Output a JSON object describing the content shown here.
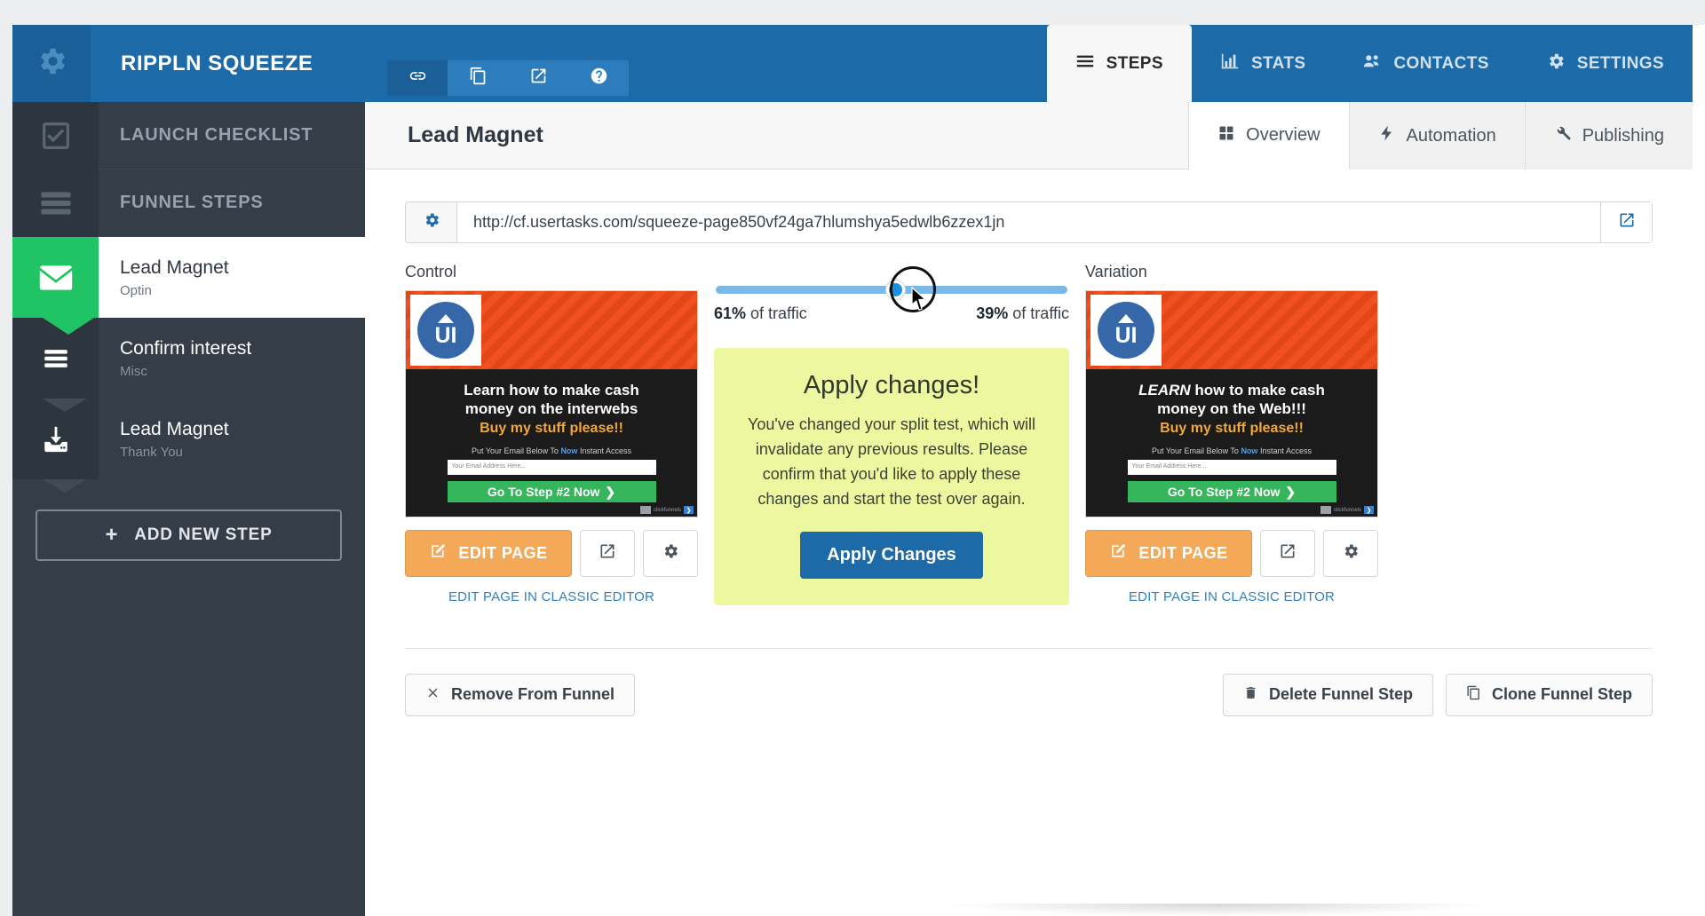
{
  "topbar": {
    "brand": "RIPPLN SQUEEZE",
    "gear_icon": "gear-icon",
    "quick_icons": [
      {
        "name": "link-icon",
        "active": true
      },
      {
        "name": "copy-icon",
        "active": false
      },
      {
        "name": "external-link-icon",
        "active": false
      },
      {
        "name": "help-circle-icon",
        "active": false
      }
    ],
    "nav_tabs": [
      {
        "label": "STEPS",
        "icon": "hamburger-icon",
        "active": true
      },
      {
        "label": "STATS",
        "icon": "bar-chart-icon",
        "active": false
      },
      {
        "label": "CONTACTS",
        "icon": "users-icon",
        "active": false
      },
      {
        "label": "SETTINGS",
        "icon": "gear-icon",
        "active": false
      }
    ]
  },
  "sidebar": {
    "headers": [
      {
        "label": "LAUNCH CHECKLIST",
        "icon": "checkbox-check-icon"
      },
      {
        "label": "FUNNEL STEPS",
        "icon": "hamburger-icon"
      }
    ],
    "steps": [
      {
        "title": "Lead Magnet",
        "subtitle": "Optin",
        "icon": "envelope-icon",
        "selected": true
      },
      {
        "title": "Confirm interest",
        "subtitle": "Misc",
        "icon": "hamburger-icon",
        "selected": false
      },
      {
        "title": "Lead Magnet",
        "subtitle": "Thank You",
        "icon": "download-inbox-icon",
        "selected": false
      }
    ],
    "add_step_label": "ADD NEW STEP",
    "add_step_plus": "+"
  },
  "main": {
    "page_title": "Lead Magnet",
    "tabs": [
      {
        "label": "Overview",
        "icon": "grid-icon",
        "active": true
      },
      {
        "label": "Automation",
        "icon": "bolt-icon",
        "active": false
      },
      {
        "label": "Publishing",
        "icon": "wrench-icon",
        "active": false
      }
    ],
    "url_bar": {
      "value": "http://cf.usertasks.com/squeeze-page850vf24ga7hlumshya5edwlb6zzex1jn",
      "settings_icon": "gear-icon",
      "open_icon": "external-link-icon"
    },
    "control": {
      "label": "Control",
      "edit_page_label": "EDIT PAGE",
      "classic_link": "EDIT PAGE IN CLASSIC EDITOR",
      "preview": {
        "logo_text": "UI",
        "headline": "Learn how to make cash",
        "headline2": "money on the interwebs",
        "subhead": "Buy my stuff please!!",
        "small_line_a": "Put Your Email Below To",
        "small_line_b": "Now",
        "small_line_c": "Instant Access",
        "input_placeholder": "Your Email Address Here...",
        "cta": "Go To Step #2 Now",
        "badge_text": "clickfunnels"
      }
    },
    "variation": {
      "label": "Variation",
      "edit_page_label": "EDIT PAGE",
      "classic_link": "EDIT PAGE IN CLASSIC EDITOR",
      "preview": {
        "logo_text": "UI",
        "headline_em": "LEARN",
        "headline": " how to make cash",
        "headline2": "money on the Web!!!",
        "subhead": "Buy my stuff please!!",
        "small_line_a": "Put Your Email Below To",
        "small_line_b": "Now",
        "small_line_c": "Instant Access",
        "input_placeholder": "Your Email Address Here...",
        "cta": "Go To Step #2 Now",
        "badge_text": "clickfunnels"
      }
    },
    "split": {
      "left_percent": "61%",
      "left_suffix": " of traffic",
      "right_percent": "39%",
      "right_suffix": " of traffic",
      "slider_position_percent": 51
    },
    "apply_panel": {
      "title": "Apply changes!",
      "body": "You've changed your split test, which will invalidate any previous results. Please confirm that you'd like to apply these changes and start the test over again.",
      "button_label": "Apply Changes"
    },
    "footer": {
      "remove_label": "Remove From Funnel",
      "remove_icon": "x-icon",
      "delete_label": "Delete Funnel Step",
      "delete_icon": "trash-icon",
      "clone_label": "Clone Funnel Step",
      "clone_icon": "copy-icon"
    }
  },
  "colors": {
    "brand_blue": "#1d6aa8",
    "sidebar_dark": "#343d48",
    "accent_green": "#21c464",
    "orange_button": "#f3a957",
    "apply_yellow": "#edf7a0",
    "link_blue": "#2f80c4"
  }
}
